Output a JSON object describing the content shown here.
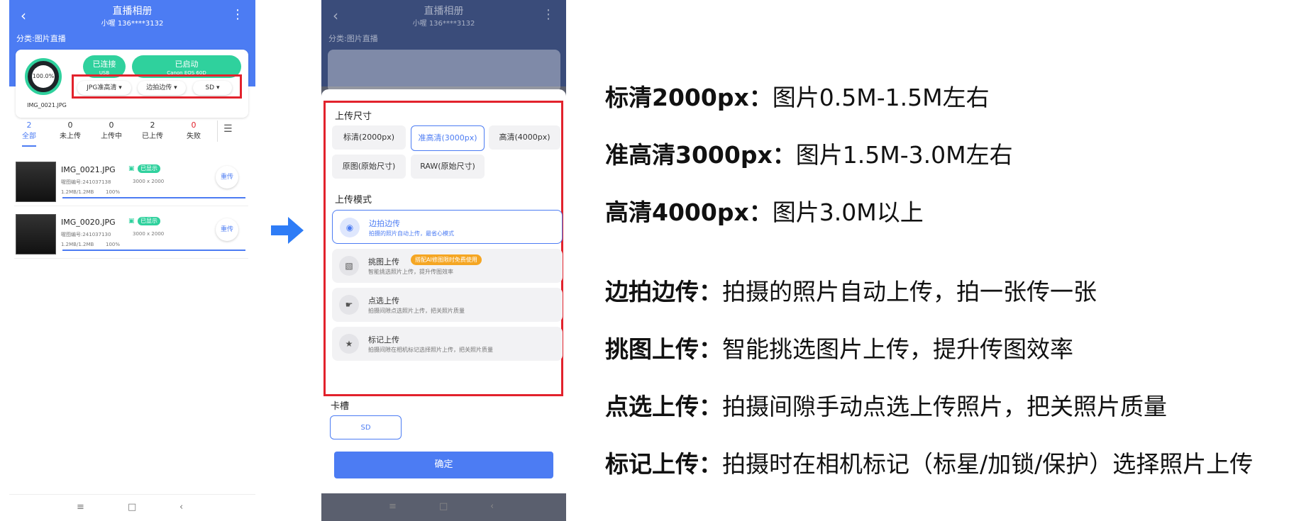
{
  "phone1": {
    "title": "直播相册",
    "subtitle": "小喔 136****3132",
    "category": "分类:图片直播",
    "progress_label": "100.0%",
    "image_name": "IMG_0021.JPG",
    "status_connected": {
      "title": "已连接",
      "sub": "USB"
    },
    "status_started": {
      "title": "已启动",
      "sub": "Canon EOS 60D"
    },
    "dropdowns": [
      "JPG准高清",
      "边拍边传",
      "SD"
    ],
    "tabs": [
      {
        "count": "2",
        "label": "全部"
      },
      {
        "count": "0",
        "label": "未上传"
      },
      {
        "count": "0",
        "label": "上传中"
      },
      {
        "count": "2",
        "label": "已上传"
      },
      {
        "count": "0",
        "label": "失败"
      }
    ],
    "files": [
      {
        "name": "IMG_0021.JPG",
        "badge": "已显示",
        "code": "喔图编号:241037138",
        "dims": "3000 x 2000",
        "size": "1.2MB/1.2MB",
        "percent": "100%",
        "action": "重传"
      },
      {
        "name": "IMG_0020.JPG",
        "badge": "已显示",
        "code": "喔图编号:241037130",
        "dims": "3000 x 2000",
        "size": "1.2MB/1.2MB",
        "percent": "100%",
        "action": "重传"
      }
    ],
    "nav": [
      "≡",
      "□",
      "‹"
    ]
  },
  "phone2": {
    "upload_size_title": "上传尺寸",
    "sizes": [
      "标清(2000px)",
      "准高清(3000px)",
      "高清(4000px)",
      "原图(原始尺寸)",
      "RAW(原始尺寸)"
    ],
    "upload_mode_title": "上传模式",
    "modes": [
      {
        "title": "边拍边传",
        "sub": "拍摄的照片自动上传，最省心模式"
      },
      {
        "title": "挑图上传",
        "sub": "智能挑选照片上传，提升传图效率",
        "promo": "搭配AI修图限时免费使用"
      },
      {
        "title": "点选上传",
        "sub": "拍摄间隙点选照片上传，把关照片质量"
      },
      {
        "title": "标记上传",
        "sub": "拍摄间隙在相机标记选择照片上传，把关照片质量"
      }
    ],
    "slot_title": "卡槽",
    "slot_value": "SD",
    "confirm": "确定"
  },
  "descriptions": [
    {
      "term": "标清2000px：",
      "text": "图片0.5M-1.5M左右"
    },
    {
      "term": "准高清3000px：",
      "text": "图片1.5M-3.0M左右"
    },
    {
      "term": "高清4000px：",
      "text": "图片3.0M以上"
    },
    {
      "term": "边拍边传：",
      "text": "拍摄的照片自动上传，拍一张传一张"
    },
    {
      "term": "挑图上传：",
      "text": "智能挑选图片上传，提升传图效率"
    },
    {
      "term": "点选上传：",
      "text": "拍摄间隙手动点选上传照片，把关照片质量"
    },
    {
      "term": "标记上传：",
      "text": "拍摄时在相机标记（标星/加锁/保护）选择照片上传"
    }
  ],
  "colors": {
    "primary": "#4c7cf3",
    "green": "#2fd19d",
    "highlight": "#e2222c",
    "promo": "#f5a623"
  }
}
